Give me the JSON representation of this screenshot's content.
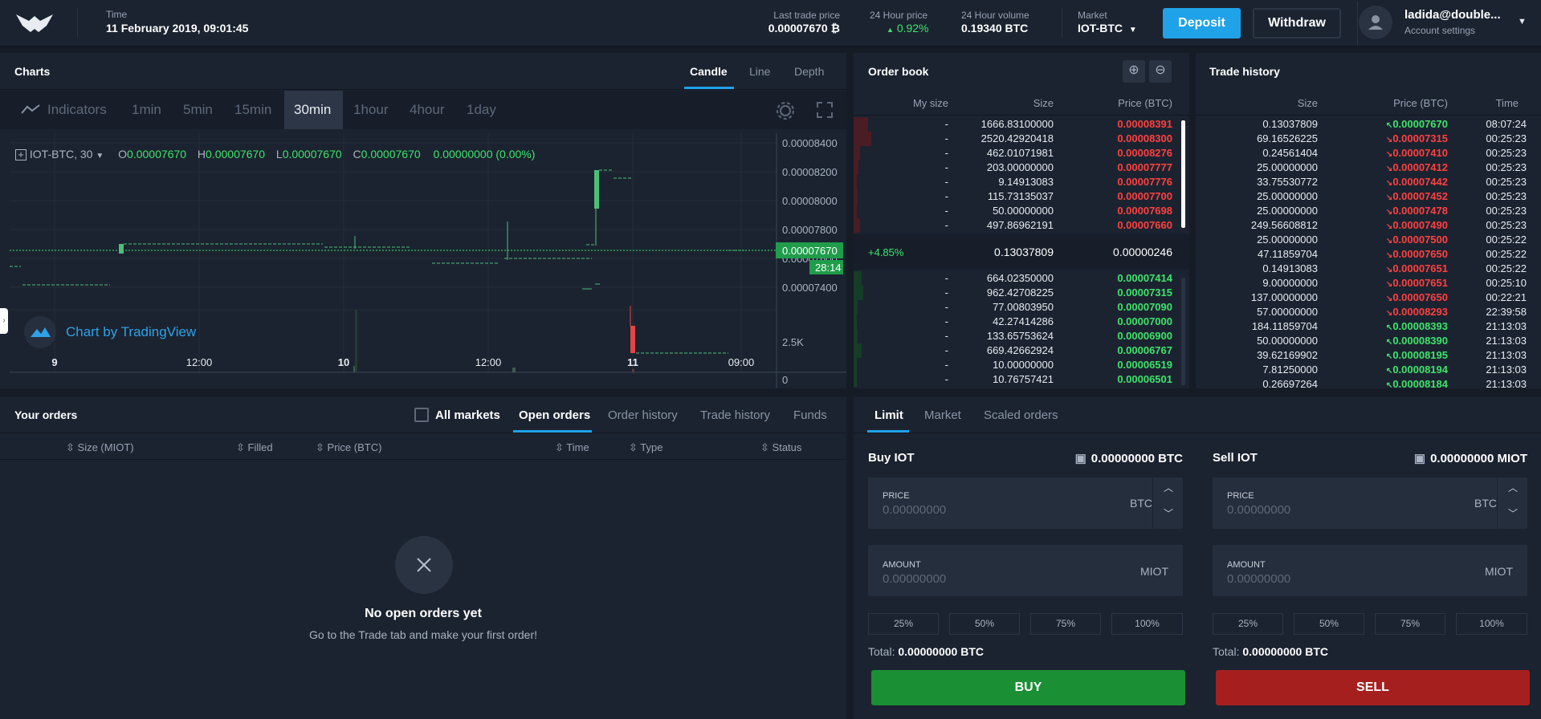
{
  "header": {
    "time_label": "Time",
    "time_value": "11 February 2019, 09:01:45",
    "last_label": "Last trade price",
    "last_value": "0.00007670 ₿",
    "h24_label": "24 Hour price",
    "h24_value": "0.92%",
    "vol_label": "24 Hour volume",
    "vol_value": "0.19340 BTC",
    "market_label": "Market",
    "market_value": "IOT-BTC",
    "deposit": "Deposit",
    "withdraw": "Withdraw",
    "user": "ladida@double...",
    "account": "Account settings"
  },
  "charts": {
    "title": "Charts",
    "tabs": [
      "Candle",
      "Line",
      "Depth"
    ],
    "indicators": "Indicators",
    "intervals": [
      "1min",
      "5min",
      "15min",
      "30min",
      "1hour",
      "4hour",
      "1day"
    ],
    "legend_symbol": "IOT-BTC, 30",
    "o": "0.00007670",
    "h": "0.00007670",
    "l": "0.00007670",
    "c": "0.00007670",
    "chg": "0.00000000 (0.00%)",
    "yticks": [
      "0.00008400",
      "0.00008200",
      "0.00008000",
      "0.00007800",
      "0.00007600",
      "0.00007400"
    ],
    "price_tag": "0.00007670",
    "timer": "28:14",
    "vol_ticks": [
      "2.5K",
      "0"
    ],
    "xticks": [
      "9",
      "12:00",
      "10",
      "12:00",
      "11",
      "09:00"
    ],
    "tv": "Chart by TradingView"
  },
  "orderbook": {
    "title": "Order book",
    "cols": [
      "My size",
      "Size",
      "Price (BTC)"
    ],
    "asks": [
      [
        "-",
        "1666.83100000",
        "0.00008391"
      ],
      [
        "-",
        "2520.42920418",
        "0.00008300"
      ],
      [
        "-",
        "462.01071981",
        "0.00008276"
      ],
      [
        "-",
        "203.00000000",
        "0.00007777"
      ],
      [
        "-",
        "9.14913083",
        "0.00007776"
      ],
      [
        "-",
        "115.73135037",
        "0.00007700"
      ],
      [
        "-",
        "50.00000000",
        "0.00007698"
      ],
      [
        "-",
        "497.86962191",
        "0.00007660"
      ]
    ],
    "spread": {
      "pct": "+4.85%",
      "size": "0.13037809",
      "price": "0.00000246"
    },
    "bids": [
      [
        "-",
        "664.02350000",
        "0.00007414"
      ],
      [
        "-",
        "962.42708225",
        "0.00007315"
      ],
      [
        "-",
        "77.00803950",
        "0.00007090"
      ],
      [
        "-",
        "42.27414286",
        "0.00007000"
      ],
      [
        "-",
        "133.65753624",
        "0.00006900"
      ],
      [
        "-",
        "669.42662924",
        "0.00006767"
      ],
      [
        "-",
        "10.00000000",
        "0.00006519"
      ],
      [
        "-",
        "10.76757421",
        "0.00006501"
      ]
    ]
  },
  "tradehistory": {
    "title": "Trade history",
    "cols": [
      "Size",
      "Price (BTC)",
      "Time"
    ],
    "rows": [
      [
        "0.13037809",
        "0.00007670",
        "08:07:24",
        "up"
      ],
      [
        "69.16526225",
        "0.00007315",
        "00:25:23",
        "down"
      ],
      [
        "0.24561404",
        "0.00007410",
        "00:25:23",
        "down"
      ],
      [
        "25.00000000",
        "0.00007412",
        "00:25:23",
        "down"
      ],
      [
        "33.75530772",
        "0.00007442",
        "00:25:23",
        "down"
      ],
      [
        "25.00000000",
        "0.00007452",
        "00:25:23",
        "down"
      ],
      [
        "25.00000000",
        "0.00007478",
        "00:25:23",
        "down"
      ],
      [
        "249.56608812",
        "0.00007490",
        "00:25:23",
        "down"
      ],
      [
        "25.00000000",
        "0.00007500",
        "00:25:22",
        "down"
      ],
      [
        "47.11859704",
        "0.00007650",
        "00:25:22",
        "down"
      ],
      [
        "0.14913083",
        "0.00007651",
        "00:25:22",
        "down"
      ],
      [
        "9.00000000",
        "0.00007651",
        "00:25:10",
        "down"
      ],
      [
        "137.00000000",
        "0.00007650",
        "00:22:21",
        "down"
      ],
      [
        "57.00000000",
        "0.00008293",
        "22:39:58",
        "down"
      ],
      [
        "184.11859704",
        "0.00008393",
        "21:13:03",
        "up"
      ],
      [
        "50.00000000",
        "0.00008390",
        "21:13:03",
        "up"
      ],
      [
        "39.62169902",
        "0.00008195",
        "21:13:03",
        "up"
      ],
      [
        "7.81250000",
        "0.00008194",
        "21:13:03",
        "up"
      ],
      [
        "0.26697264",
        "0.00008184",
        "21:13:03",
        "up"
      ]
    ]
  },
  "orders": {
    "title": "Your orders",
    "all_markets": "All markets",
    "tabs": [
      "Open orders",
      "Order history",
      "Trade history",
      "Funds"
    ],
    "cols": [
      "Size (MIOT)",
      "Filled",
      "Price (BTC)",
      "Time",
      "Type",
      "Status"
    ],
    "empty_title": "No open orders yet",
    "empty_sub": "Go to the Trade tab and make your first order!"
  },
  "trade": {
    "tabs": [
      "Limit",
      "Market",
      "Scaled orders"
    ],
    "buy": {
      "title": "Buy IOT",
      "balance": "0.00000000 BTC",
      "price_label": "PRICE",
      "price_ph": "0.00000000",
      "price_unit": "BTC",
      "amount_label": "AMOUNT",
      "amount_ph": "0.00000000",
      "amount_unit": "MIOT",
      "pcts": [
        "25%",
        "50%",
        "75%",
        "100%"
      ],
      "total_label": "Total:",
      "total_value": "0.00000000 BTC",
      "button": "BUY"
    },
    "sell": {
      "title": "Sell IOT",
      "balance": "0.00000000 MIOT",
      "price_label": "PRICE",
      "price_ph": "0.00000000",
      "price_unit": "BTC",
      "amount_label": "AMOUNT",
      "amount_ph": "0.00000000",
      "amount_unit": "MIOT",
      "pcts": [
        "25%",
        "50%",
        "75%",
        "100%"
      ],
      "total_label": "Total:",
      "total_value": "0.00000000 BTC",
      "button": "SELL"
    }
  },
  "colors": {
    "accent": "#1fa2e8",
    "buy": "#1a8f34",
    "sell": "#a61f1f",
    "up": "#3ee46a",
    "down": "#ff4040"
  }
}
